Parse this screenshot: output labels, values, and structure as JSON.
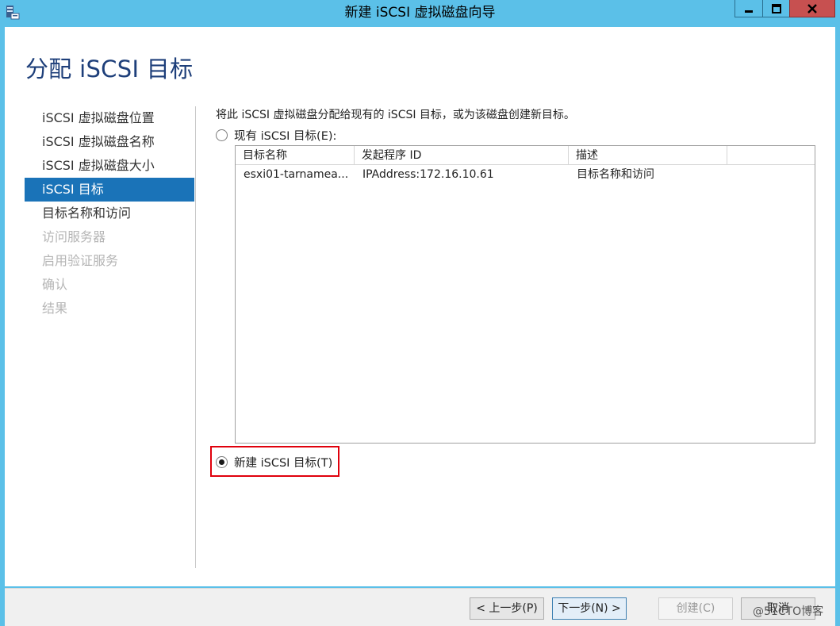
{
  "window": {
    "title": "新建 iSCSI 虚拟磁盘向导",
    "icons": {
      "app": "server-manager-icon",
      "minimize": "minimize-icon",
      "maximize": "maximize-icon",
      "close": "close-icon"
    }
  },
  "page": {
    "title": "分配 iSCSI 目标"
  },
  "nav": {
    "items": [
      {
        "label": "iSCSI 虚拟磁盘位置",
        "state": "normal"
      },
      {
        "label": "iSCSI 虚拟磁盘名称",
        "state": "normal"
      },
      {
        "label": "iSCSI 虚拟磁盘大小",
        "state": "normal"
      },
      {
        "label": "iSCSI 目标",
        "state": "active"
      },
      {
        "label": "目标名称和访问",
        "state": "normal"
      },
      {
        "label": "访问服务器",
        "state": "disabled"
      },
      {
        "label": "启用验证服务",
        "state": "disabled"
      },
      {
        "label": "确认",
        "state": "disabled"
      },
      {
        "label": "结果",
        "state": "disabled"
      }
    ]
  },
  "main": {
    "description": "将此 iSCSI 虚拟磁盘分配给现有的 iSCSI 目标，或为该磁盘创建新目标。",
    "option_existing": {
      "label": "现有 iSCSI 目标(E):",
      "selected": false
    },
    "option_new": {
      "label": "新建 iSCSI 目标(T)",
      "selected": true
    },
    "table": {
      "columns": [
        "目标名称",
        "发起程序 ID",
        "描述",
        ""
      ],
      "rows": [
        [
          "esxi01-tarnamea...",
          "IPAddress:172.16.10.61",
          "目标名称和访问",
          ""
        ]
      ]
    }
  },
  "footer": {
    "prev": "< 上一步(P)",
    "next": "下一步(N) >",
    "create": "创建(C)",
    "cancel": "取消"
  },
  "watermark": "@51CTO博客",
  "colors": {
    "titlebar": "#5bc0e8",
    "accent": "#1a73b8",
    "title_text": "#1e3f7a",
    "highlight": "#e0000c"
  }
}
